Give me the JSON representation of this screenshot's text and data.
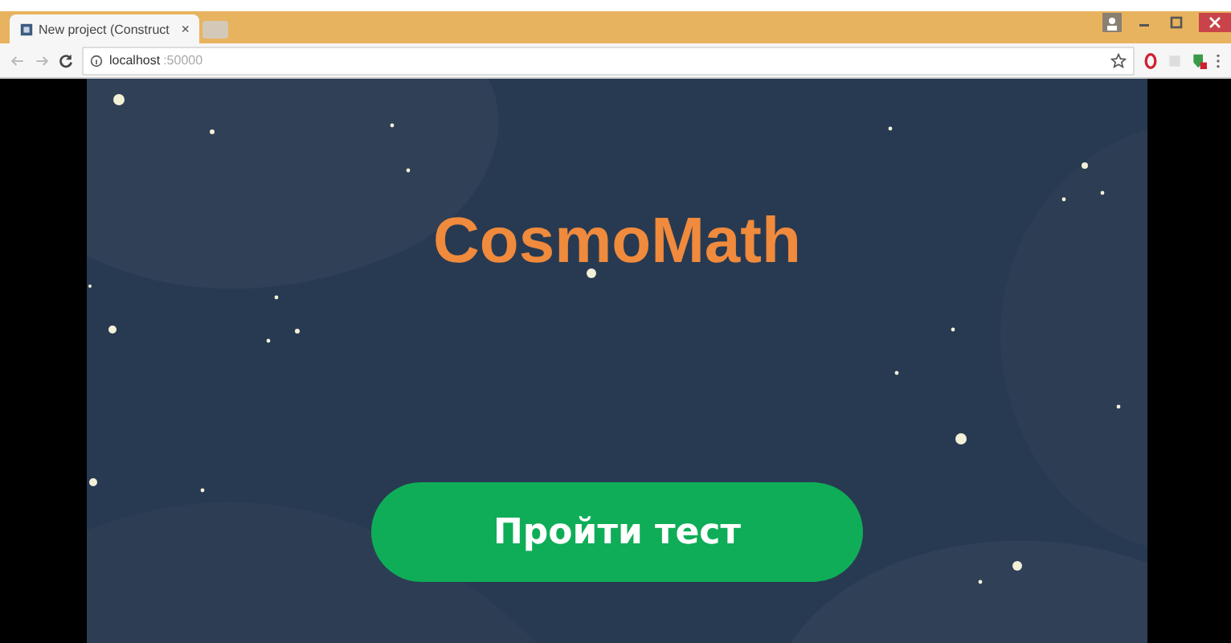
{
  "browser": {
    "tabs": [
      {
        "title": "New project (Construct",
        "selected": true
      },
      {
        "selected": false
      }
    ],
    "close_glyph": "×",
    "address": {
      "host": "localhost",
      "port": ":50000"
    }
  },
  "game": {
    "title": "CosmoMath",
    "button": "Пройти тест"
  }
}
